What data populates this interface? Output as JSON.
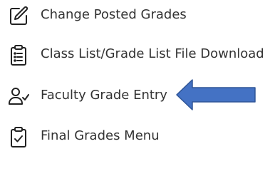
{
  "menu": {
    "items": [
      {
        "label": "Change Posted Grades",
        "icon": "edit-icon"
      },
      {
        "label": "Class List/Grade List File Download",
        "icon": "clipboard-list-icon"
      },
      {
        "label": "Faculty Grade Entry",
        "icon": "user-check-icon"
      },
      {
        "label": "Final Grades Menu",
        "icon": "clipboard-check-icon"
      }
    ]
  },
  "annotation": {
    "arrow_color": "#4472c4",
    "arrow_direction": "left",
    "points_to": "Faculty Grade Entry"
  },
  "colors": {
    "text": "#333333",
    "icon": "#222222"
  }
}
